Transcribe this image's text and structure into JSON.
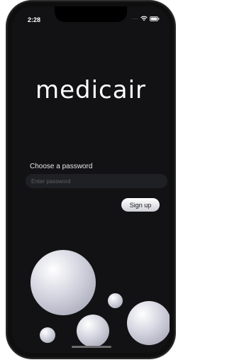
{
  "status_bar": {
    "time": "2:28",
    "signal_dots": "....",
    "icons": [
      "wifi-icon",
      "battery-icon"
    ]
  },
  "app": {
    "logo_text": "medicair"
  },
  "form": {
    "password_label": "Choose a password",
    "password_placeholder": "Enter password",
    "password_value": "",
    "signup_label": "Sign up"
  },
  "colors": {
    "background": "#121214",
    "input_background": "#1f2024",
    "button_light": "#ffffff",
    "bubble_dark": "#9b9cad"
  }
}
